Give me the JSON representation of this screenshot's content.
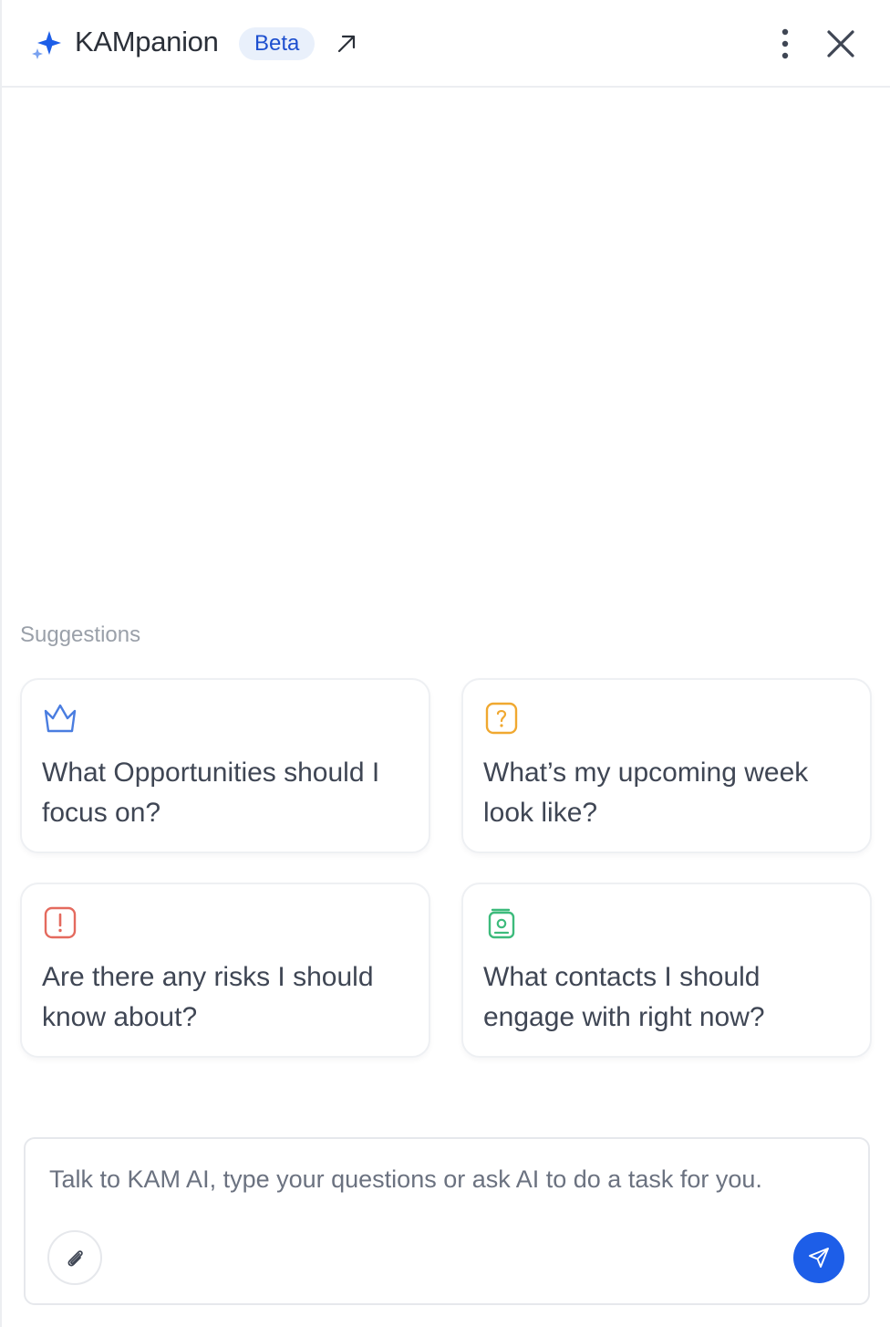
{
  "header": {
    "title": "KAMpanion",
    "badge": "Beta",
    "icons": {
      "logo": "sparkle-icon",
      "expand": "arrow-up-right-icon",
      "more": "more-vertical-icon",
      "close": "close-icon"
    }
  },
  "suggestions": {
    "label": "Suggestions",
    "items": [
      {
        "icon": "crown-icon",
        "color": "#4a7de0",
        "text": "What Opportunities should I focus on?"
      },
      {
        "icon": "question-icon",
        "color": "#f0a830",
        "text": "What’s my upcoming week look like?"
      },
      {
        "icon": "alert-icon",
        "color": "#e46a5e",
        "text": "Are there any risks I should know about?"
      },
      {
        "icon": "contact-book-icon",
        "color": "#3dbb7c",
        "text": "What contacts I should engage with right now?"
      }
    ]
  },
  "composer": {
    "placeholder": "Talk to KAM AI, type your questions or ask AI to do a task for you.",
    "attach_icon": "paperclip-icon",
    "send_icon": "send-icon"
  },
  "colors": {
    "accent": "#1d5ee8",
    "badge_bg": "#e9f0fb",
    "badge_text": "#1d4fcf"
  }
}
